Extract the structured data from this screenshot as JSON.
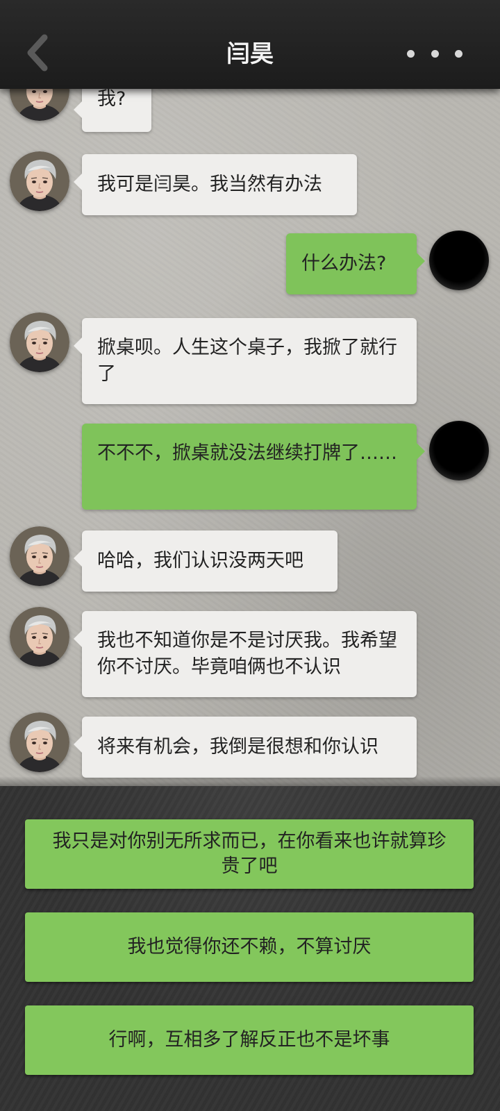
{
  "header": {
    "title": "闫昊",
    "back_icon": "chevron-left-icon",
    "more_icon": "more-dots-icon"
  },
  "messages": [
    {
      "sender": "other",
      "text": "我?"
    },
    {
      "sender": "other",
      "text": "我可是闫昊。我当然有办法"
    },
    {
      "sender": "me",
      "text": "什么办法?"
    },
    {
      "sender": "other",
      "text": "掀桌呗。人生这个桌子，我掀了就行了"
    },
    {
      "sender": "me",
      "text": "不不不，掀桌就没法继续打牌了……"
    },
    {
      "sender": "other",
      "text": "哈哈，我们认识没两天吧"
    },
    {
      "sender": "other",
      "text": "我也不知道你是不是讨厌我。我希望你不讨厌。毕竟咱俩也不认识"
    },
    {
      "sender": "other",
      "text": "将来有机会，我倒是很想和你认识"
    }
  ],
  "options": [
    {
      "label": "我只是对你别无所求而已，在你看来也许就算珍贵了吧"
    },
    {
      "label": "我也觉得你还不赖，不算讨厌"
    },
    {
      "label": "行啊，互相多了解反正也不是坏事"
    }
  ],
  "colors": {
    "incoming_bubble": "#efeeec",
    "outgoing_bubble": "#7fc35a",
    "option_button": "#83c75c",
    "header": "#1f1f1f"
  }
}
